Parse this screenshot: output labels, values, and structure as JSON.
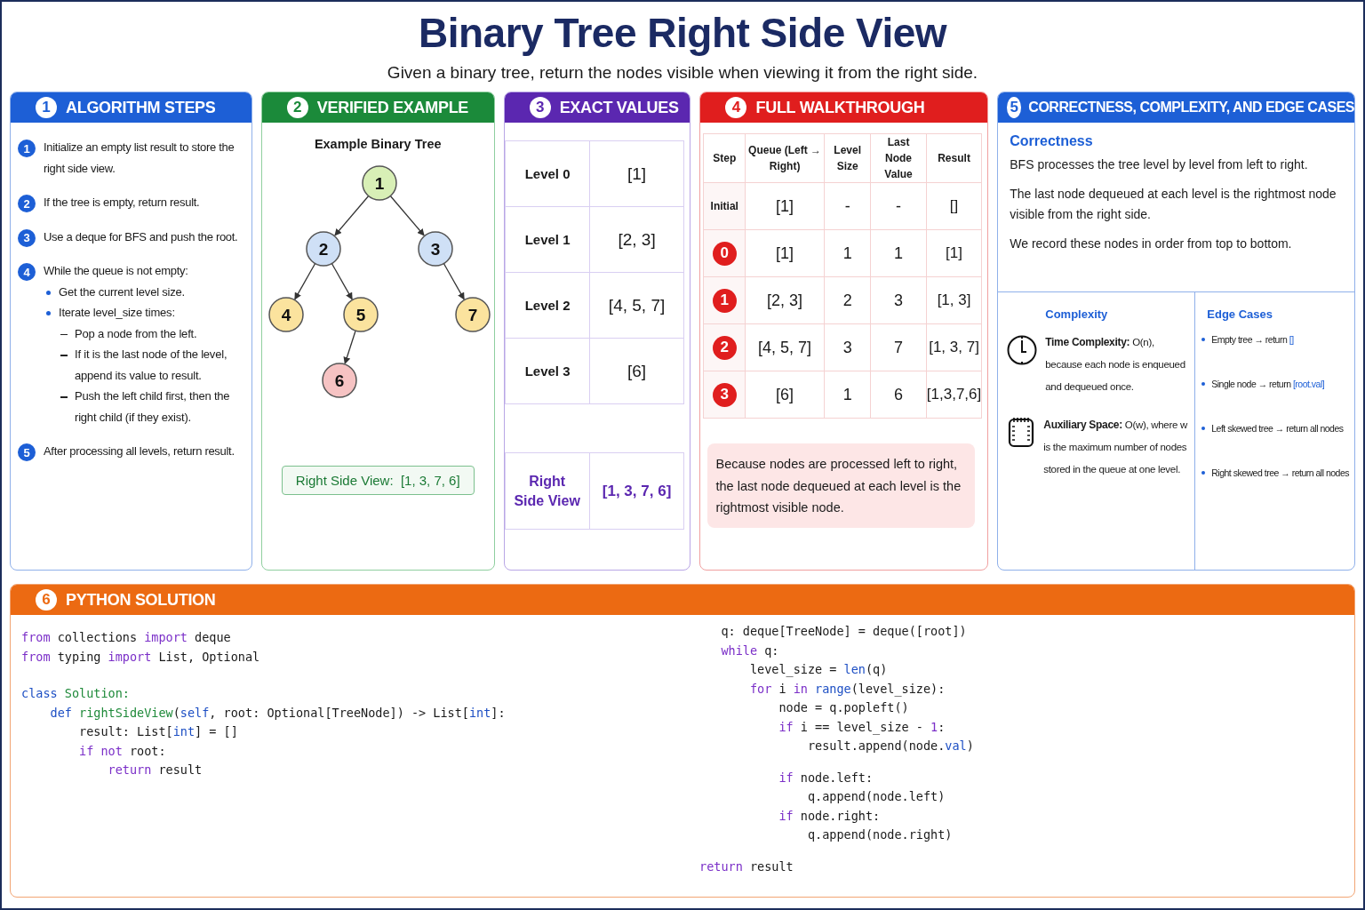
{
  "title": "Binary Tree Right Side View",
  "subtitle": "Given a binary tree, return the nodes visible when viewing it from the right side.",
  "algorithm_steps": {
    "number": "1",
    "title": "ALGORITHM STEPS",
    "steps": [
      {
        "number": "1",
        "text": "Initialize an empty list result to store the right side view."
      },
      {
        "number": "2",
        "text": "If the tree is empty, return result."
      },
      {
        "number": "3",
        "text": "Use a deque for BFS and push the root."
      },
      {
        "number": "4",
        "text": "While the queue is not empty:",
        "children": [
          {
            "text": "Get the current level size."
          },
          {
            "text": "Iterate level_size times:",
            "children": [
              {
                "text": "Pop a node from the left."
              },
              {
                "text": "If it is the last node of the level, append its value to result."
              },
              {
                "text": "Push the left child first, then the right child (if they exist)."
              }
            ]
          }
        ]
      },
      {
        "number": "5",
        "text": "After processing all levels, return result."
      }
    ]
  },
  "verified_example": {
    "number": "2",
    "title": "VERIFIED EXAMPLE",
    "tree_title": "Example Binary Tree",
    "tree": {
      "value": "1",
      "color": "#d8efb6",
      "left": {
        "value": "2",
        "color": "#cfe0f6",
        "left": {
          "value": "4",
          "color": "#fbe39e"
        },
        "right": {
          "value": "5",
          "color": "#fbe39e",
          "left": {
            "value": "6",
            "color": "#f6c3c3"
          }
        }
      },
      "right": {
        "value": "3",
        "color": "#cfe0f6",
        "right": {
          "value": "7",
          "color": "#fbe39e"
        }
      }
    },
    "result": "Right Side View:  [1, 3, 7, 6]"
  },
  "exact_values": {
    "number": "3",
    "title": "EXACT VALUES",
    "rows": [
      {
        "label": "Level 0",
        "value": "[1]"
      },
      {
        "label": "Level 1",
        "value": "[2, 3]"
      },
      {
        "label": "Level 2",
        "value": "[4, 5, 7]"
      },
      {
        "label": "Level 3",
        "value": "[6]"
      }
    ],
    "summary": {
      "label": "Right Side View",
      "value": "[1, 3, 7, 6]"
    }
  },
  "walkthrough": {
    "number": "4",
    "title": "FULL WALKTHROUGH",
    "columns": [
      "Step",
      "Queue (Left → Right)",
      "Level Size",
      "Last Node Value",
      "Result"
    ],
    "rows": [
      {
        "kind": "label",
        "cells": [
          "Initial",
          "[1]",
          "-",
          "-",
          "[]"
        ]
      },
      {
        "kind": "badge",
        "cells": [
          "0",
          "[1]",
          "1",
          "1",
          "[1]"
        ]
      },
      {
        "kind": "badge",
        "cells": [
          "1",
          "[2, 3]",
          "2",
          "3",
          "[1, 3]"
        ]
      },
      {
        "kind": "badge",
        "cells": [
          "2",
          "[4, 5, 7]",
          "3",
          "7",
          "[1, 3, 7]"
        ]
      },
      {
        "kind": "badge",
        "cells": [
          "3",
          "[6]",
          "1",
          "6",
          "[1,3,7,6]"
        ]
      }
    ],
    "note": "Because nodes are processed left to right, the last node dequeued at each level is the rightmost visible node."
  },
  "analysis": {
    "number": "5",
    "title": "CORRECTNESS, COMPLEXITY, AND EDGE CASES",
    "correctness": {
      "heading": "Correctness",
      "paragraphs": [
        "BFS processes the tree level by level from left to right.",
        "The last node dequeued at each level is the rightmost node visible from the right side.",
        "We record these nodes in order from top to bottom."
      ]
    },
    "complexity": {
      "heading": "Complexity",
      "items": [
        {
          "kind": "time",
          "text": "**Time Complexity:**   O(n), because each node is enqueued and dequeued once."
        },
        {
          "kind": "space",
          "text": "**Auxiliary Space:**   O(w), where w is the maximum number of nodes stored in the queue at one level."
        }
      ]
    },
    "edge_cases": {
      "heading": "Edge Cases",
      "items": [
        {
          "text": "Empty tree → return ",
          "code": "[]"
        },
        {
          "text": "Single node → return ",
          "code": "[root.val]"
        },
        {
          "text": "Left skewed tree → return all nodes"
        },
        {
          "text": "Right skewed tree → return all nodes"
        }
      ]
    }
  },
  "code": {
    "number": "6",
    "title": "PYTHON SOLUTION",
    "columns": [
      [
        {
          "kind": "code",
          "tokens": [
            {
              "kind": "keyword",
              "text": "from"
            },
            {
              "kind": "plain",
              "text": " collections "
            },
            {
              "kind": "keyword",
              "text": "import"
            },
            {
              "kind": "plain",
              "text": " deque"
            }
          ]
        },
        {
          "kind": "code",
          "tokens": [
            {
              "kind": "keyword",
              "text": "from"
            },
            {
              "kind": "plain",
              "text": " typing "
            },
            {
              "kind": "keyword",
              "text": "import"
            },
            {
              "kind": "plain",
              "text": " List, Optional"
            }
          ]
        },
        {
          "kind": "blank"
        },
        {
          "kind": "code",
          "tokens": [
            {
              "kind": "builtin",
              "text": "class"
            },
            {
              "kind": "name",
              "text": " Solution:"
            }
          ]
        },
        {
          "kind": "code",
          "tokens": [
            {
              "kind": "builtin",
              "text": "    def"
            },
            {
              "kind": "name",
              "text": " rightSideView"
            },
            {
              "kind": "plain",
              "text": "("
            },
            {
              "kind": "builtin",
              "text": "self"
            },
            {
              "kind": "plain",
              "text": ", root: Optional[TreeNode]) -> List["
            },
            {
              "kind": "builtin",
              "text": "int"
            },
            {
              "kind": "plain",
              "text": "]:"
            }
          ]
        },
        {
          "kind": "code",
          "tokens": [
            {
              "kind": "plain",
              "text": "        result: List["
            },
            {
              "kind": "builtin",
              "text": "int"
            },
            {
              "kind": "plain",
              "text": "] = []"
            }
          ]
        },
        {
          "kind": "code",
          "tokens": [
            {
              "kind": "keyword",
              "text": "        if"
            },
            {
              "kind": "keyword",
              "text": " not"
            },
            {
              "kind": "plain",
              "text": " root:"
            }
          ]
        },
        {
          "kind": "code",
          "tokens": [
            {
              "kind": "keyword",
              "text": "            return"
            },
            {
              "kind": "plain",
              "text": " result"
            }
          ]
        }
      ],
      [
        {
          "kind": "code",
          "tokens": [
            {
              "kind": "plain",
              "text": "   q: deque[TreeNode] = deque([root])"
            }
          ]
        },
        {
          "kind": "code",
          "tokens": [
            {
              "kind": "keyword",
              "text": "   while"
            },
            {
              "kind": "plain",
              "text": " q:"
            }
          ]
        },
        {
          "kind": "code",
          "tokens": [
            {
              "kind": "plain",
              "text": "       level_size = "
            },
            {
              "kind": "builtin",
              "text": "len"
            },
            {
              "kind": "plain",
              "text": "(q)"
            }
          ]
        },
        {
          "kind": "code",
          "tokens": [
            {
              "kind": "keyword",
              "text": "       for"
            },
            {
              "kind": "plain",
              "text": " i"
            },
            {
              "kind": "keyword",
              "text": " in"
            },
            {
              "kind": "builtin",
              "text": " range"
            },
            {
              "kind": "plain",
              "text": "(level_size):"
            }
          ]
        },
        {
          "kind": "code",
          "tokens": [
            {
              "kind": "plain",
              "text": "           node = q.popleft()"
            }
          ]
        },
        {
          "kind": "code",
          "tokens": [
            {
              "kind": "keyword",
              "text": "           if"
            },
            {
              "kind": "plain",
              "text": " i == level_size - "
            },
            {
              "kind": "keyword",
              "text": "1"
            },
            {
              "kind": "plain",
              "text": ":"
            }
          ]
        },
        {
          "kind": "code",
          "tokens": [
            {
              "kind": "plain",
              "text": "               result.append(node."
            },
            {
              "kind": "builtin",
              "text": "val"
            },
            {
              "kind": "plain",
              "text": ")"
            }
          ]
        },
        {
          "kind": "blank"
        },
        {
          "kind": "code",
          "tokens": [
            {
              "kind": "keyword",
              "text": "           if"
            },
            {
              "kind": "plain",
              "text": " node.left:"
            }
          ]
        },
        {
          "kind": "code",
          "tokens": [
            {
              "kind": "plain",
              "text": "               q.append(node.left)"
            }
          ]
        },
        {
          "kind": "code",
          "tokens": [
            {
              "kind": "keyword",
              "text": "           if"
            },
            {
              "kind": "plain",
              "text": " node.right:"
            }
          ]
        },
        {
          "kind": "code",
          "tokens": [
            {
              "kind": "plain",
              "text": "               q.append(node.right)"
            }
          ]
        },
        {
          "kind": "blank"
        },
        {
          "kind": "code",
          "tokens": [
            {
              "kind": "keyword",
              "text": "return"
            },
            {
              "kind": "plain",
              "text": " result"
            }
          ]
        }
      ]
    ]
  }
}
